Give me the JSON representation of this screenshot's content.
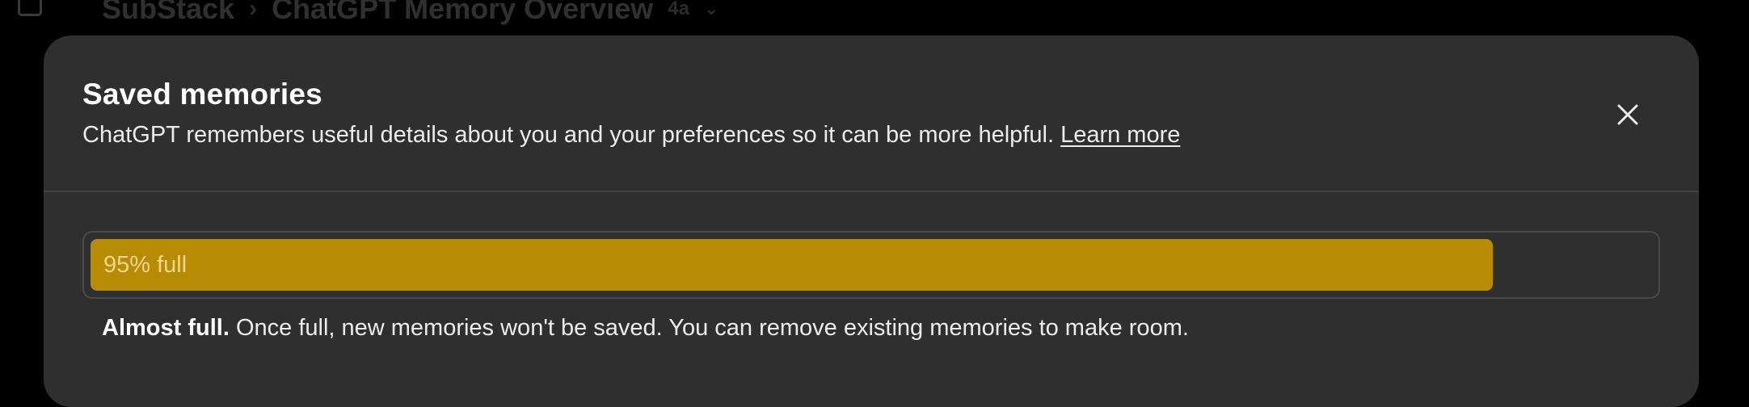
{
  "breadcrumb": {
    "workspace": "SubStack",
    "separator": "›",
    "page": "ChatGPT Memory Overview",
    "chip": "4a"
  },
  "modal": {
    "title": "Saved memories",
    "description": "ChatGPT remembers useful details about you and your preferences so it can be more helpful.",
    "learn_more": "Learn more",
    "close_icon": "close-icon"
  },
  "memory": {
    "percent_full": 95,
    "label": "95% full",
    "fill_color": "#b88b04",
    "notice_bold": "Almost full.",
    "notice_text": " Once full, new memories won't be saved. You can remove existing memories to make room."
  }
}
